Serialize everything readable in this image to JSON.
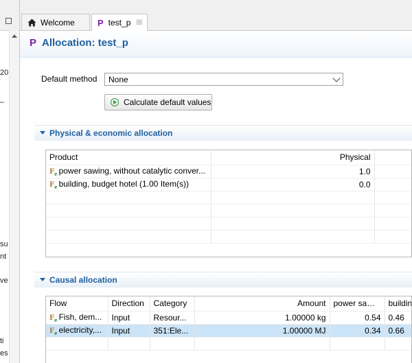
{
  "left_panel": {
    "fragments": [
      "20",
      "–",
      "su",
      "nt",
      "ve",
      "ti",
      "es"
    ]
  },
  "tabs": [
    {
      "label": "Welcome",
      "icon": "home-icon"
    },
    {
      "label": "test_p",
      "icon": "process-p-icon",
      "close": "☒"
    }
  ],
  "editor": {
    "title_icon": "P",
    "title": "Allocation: test_p",
    "default_method_label": "Default method",
    "default_method_value": "None",
    "calculate_button": "Calculate default values"
  },
  "physical_section": {
    "title": "Physical & economic allocation",
    "columns": [
      "Product",
      "Physical"
    ],
    "rows": [
      {
        "product": "power sawing, without catalytic conver...",
        "physical": "1.0"
      },
      {
        "product": "building, budget hotel (1.00 Item(s))",
        "physical": "0.0"
      }
    ]
  },
  "causal_section": {
    "title": "Causal allocation",
    "columns": [
      "Flow",
      "Direction",
      "Category",
      "Amount",
      "power sawi...",
      "building, b..."
    ],
    "rows": [
      {
        "flow": "Fish, dem...",
        "direction": "Input",
        "category": "Resour...",
        "amount": "1.00000 kg",
        "power": "0.54",
        "building": "0.46",
        "selected": false
      },
      {
        "flow": "electricity,...",
        "direction": "Input",
        "category": "351:Ele...",
        "amount": "1.00000 MJ",
        "power": "0.34",
        "building": "0.66",
        "selected": true
      }
    ]
  },
  "colors": {
    "title_blue": "#1f5fa0",
    "process_purple": "#7a1fa2",
    "selection": "#cce4f7"
  }
}
